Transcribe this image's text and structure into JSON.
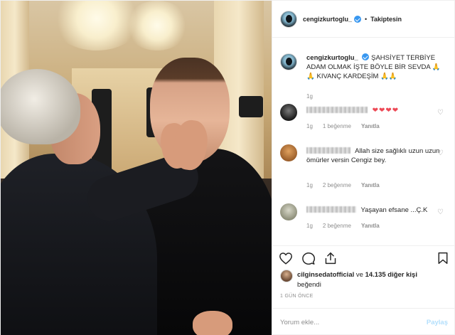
{
  "post": {
    "username": "cengizkurtoglu_",
    "follow_label": "Takiptesin",
    "dot": "•",
    "caption": {
      "username": "cengizkurtoglu_",
      "text_line1": "ŞAHSİYET TERBİYE",
      "text_line2": "ADAM OLMAK İŞTE BÖYLE BİR SEVDA",
      "text_line3": "KIVANÇ KARDEŞİM",
      "emoji": "🙏🙏",
      "emoji_end": "🙏🙏",
      "time": "1g"
    },
    "comments": [
      {
        "hearts": "❤❤❤❤",
        "time": "1g",
        "likes": "1 beğenme",
        "reply": "Yanıtla"
      },
      {
        "text": "Allah size sağlıklı uzun uzun ömürler versin Cengiz bey.",
        "time": "1g",
        "likes": "2 beğenme",
        "reply": "Yanıtla"
      },
      {
        "text": "Yaşayan efsane ...Ç.K",
        "time": "1g",
        "likes": "2 beğenme",
        "reply": "Yanıtla"
      }
    ],
    "likes": {
      "user": "cilginsedatofficial",
      "connector": "ve",
      "others": "14.135 diğer kişi",
      "suffix": "beğendi"
    },
    "timestamp": "1 GÜN ÖNCE",
    "add_comment_placeholder": "Yorum ekle...",
    "post_button": "Paylaş"
  },
  "icons": {
    "heart": "heart-icon",
    "comment": "comment-icon",
    "share": "share-icon",
    "save": "bookmark-icon",
    "verified": "verified-badge-icon"
  },
  "colors": {
    "verified": "#3897f0",
    "heart_red": "#ed4956",
    "muted": "#8e8e8e",
    "post_button_disabled": "#b2dffc"
  }
}
